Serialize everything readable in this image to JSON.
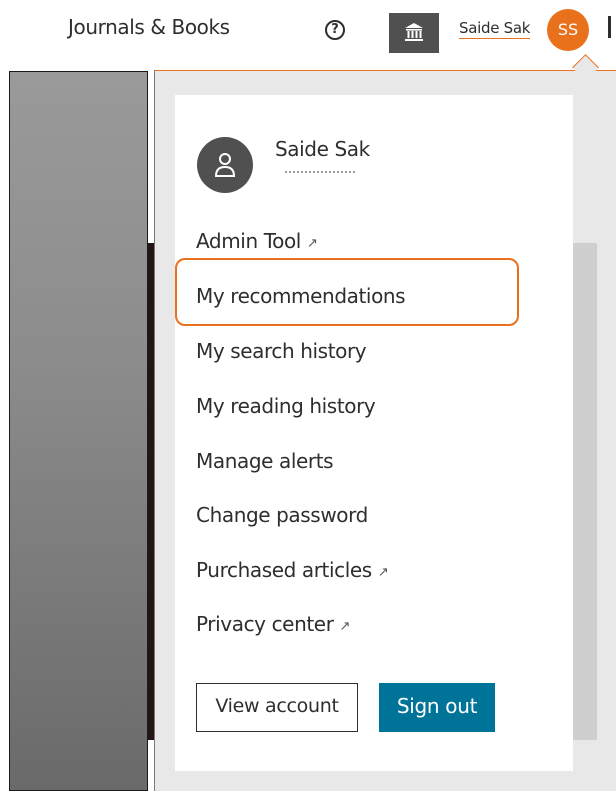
{
  "header": {
    "journals_books": "Journals & Books",
    "help_icon": "question-circle-icon",
    "help_glyph": "?",
    "institution_icon": "institution-icon",
    "user_name": "Saide Sak",
    "user_initials": "SS"
  },
  "dropdown": {
    "profile_name": "Saide Sak",
    "profile_icon": "person-icon",
    "items": [
      {
        "label": "Admin Tool",
        "external": true
      },
      {
        "label": "My recommendations",
        "external": false
      },
      {
        "label": "My search history",
        "external": false
      },
      {
        "label": "My reading history",
        "external": false
      },
      {
        "label": "Manage alerts",
        "external": false
      },
      {
        "label": "Change password",
        "external": false
      },
      {
        "label": "Purchased articles",
        "external": true
      },
      {
        "label": "Privacy center",
        "external": true
      }
    ],
    "external_arrow": "↗",
    "view_account": "View account",
    "sign_out": "Sign out"
  },
  "colors": {
    "accent_orange": "#e9711c",
    "button_blue": "#007398",
    "icon_dark": "#505050"
  }
}
